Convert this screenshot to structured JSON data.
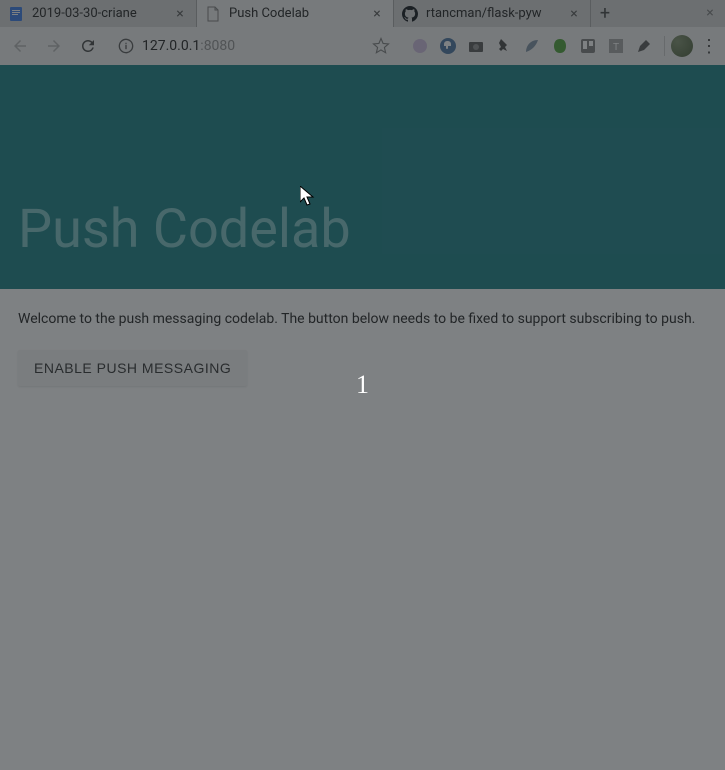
{
  "tabs": [
    {
      "title": "2019-03-30-criane",
      "icon": "doc"
    },
    {
      "title": "Push Codelab",
      "icon": "page"
    },
    {
      "title": "rtancman/flask-pyw",
      "icon": "github"
    }
  ],
  "address": {
    "host": "127.0.0.1",
    "port": ":8080"
  },
  "hero": {
    "title": "Push Codelab"
  },
  "page": {
    "intro": "Welcome to the push messaging codelab. The button below needs to be fixed to support subscribing to push.",
    "button_label": "ENABLE PUSH MESSAGING"
  },
  "overlay": {
    "counter": "1"
  }
}
